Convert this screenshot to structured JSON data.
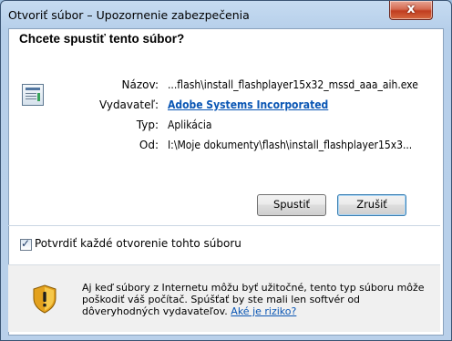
{
  "window": {
    "title": "Otvoriť súbor – Upozornenie zabezpečenia",
    "close_label": "x"
  },
  "dialog": {
    "heading": "Chcete spustiť tento súbor?",
    "fields": [
      {
        "label": "Názov:",
        "value": "...flash\\install_flashplayer15x32_mssd_aaa_aih.exe"
      },
      {
        "label": "Vydavateľ:",
        "value": "Adobe Systems Incorporated"
      },
      {
        "label": "Typ:",
        "value": "Aplikácia"
      },
      {
        "label": "Od:",
        "value": "I:\\Moje dokumenty\\flash\\install_flashplayer15x3..."
      }
    ],
    "buttons": {
      "run": "Spustiť",
      "cancel": "Zrušiť"
    },
    "checkbox": {
      "label": "Potvrdiť každé otvorenie tohto súboru",
      "checked": true
    },
    "warning": {
      "text": "Aj keď súbory z Internetu môžu byť užitočné, tento typ súboru môže poškodiť váš počítač. Spúšťať by ste mali len softvér od dôveryhodných vydavateľov.",
      "link": "Aké je riziko?"
    }
  },
  "colors": {
    "link": "#0a56b4",
    "titlebar": "#b9d0ea",
    "close": "#c13d20"
  },
  "icons": [
    "file-icon",
    "shield-warning-icon",
    "checkmark-icon",
    "close-icon"
  ]
}
